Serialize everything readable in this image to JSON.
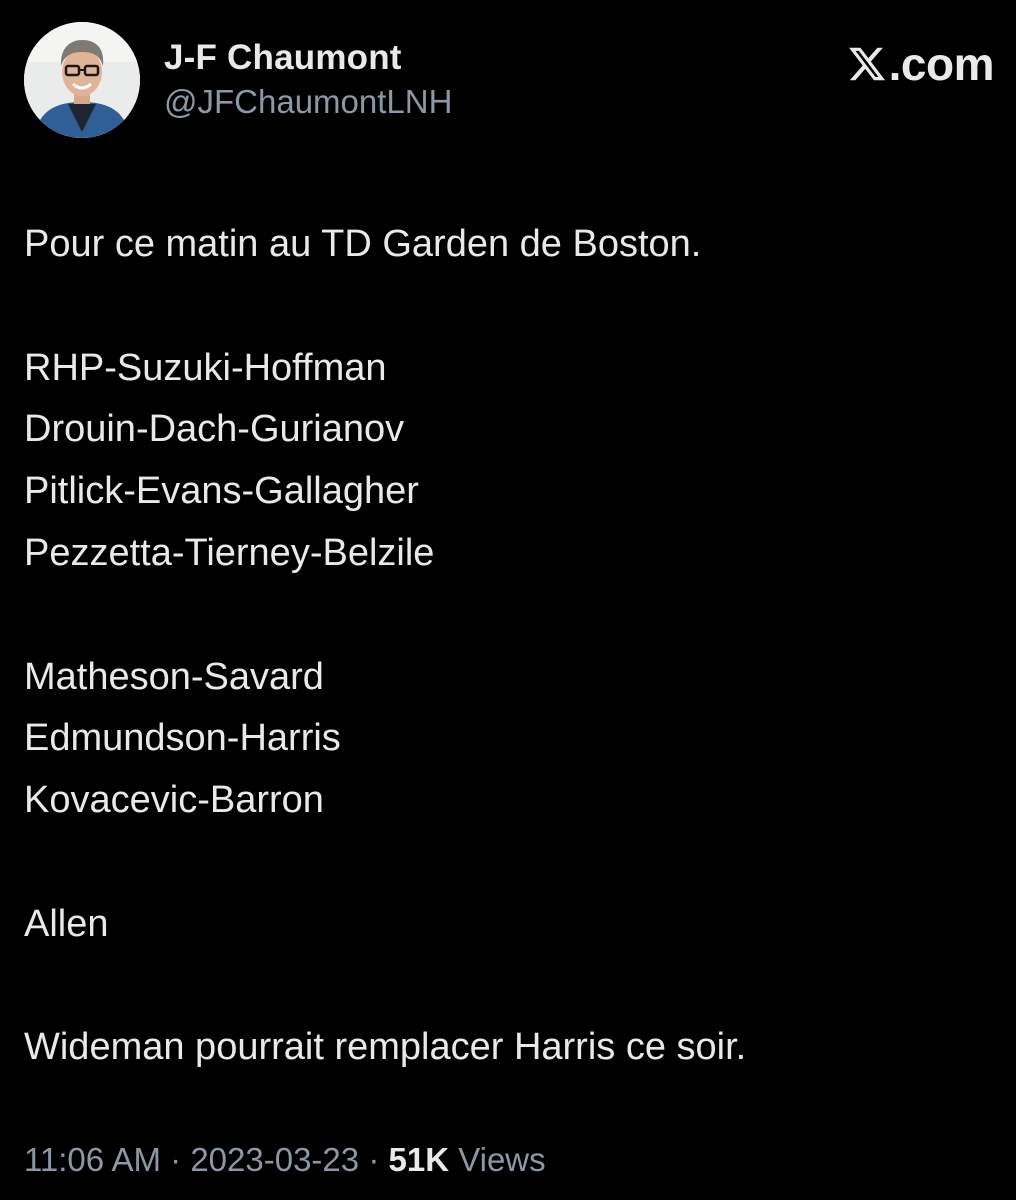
{
  "author": {
    "display_name": "J-F Chaumont",
    "handle": "@JFChaumontLNH",
    "avatar_icon": "profile-photo"
  },
  "site": {
    "logo_icon": "x-logo-icon",
    "domain": ".com"
  },
  "tweet": {
    "lines": [
      "Pour ce matin au TD Garden de Boston.",
      "",
      "RHP-Suzuki-Hoffman",
      "Drouin-Dach-Gurianov",
      "Pitlick-Evans-Gallagher",
      "Pezzetta-Tierney-Belzile",
      "",
      "Matheson-Savard",
      "Edmundson-Harris",
      "Kovacevic-Barron",
      "",
      "Allen",
      "",
      "Wideman pourrait remplacer Harris ce soir."
    ]
  },
  "meta": {
    "time": "11:06 AM",
    "separator": "·",
    "date": "2023-03-23",
    "views_count": "51K",
    "views_label": "Views"
  },
  "colors": {
    "background": "#000000",
    "primary_text": "#e7e9ea",
    "secondary_text": "#8b98a5"
  }
}
